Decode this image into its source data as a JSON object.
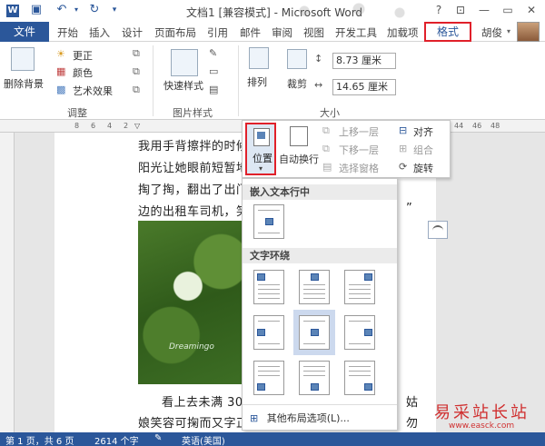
{
  "titlebar": {
    "title": "文档1 [兼容模式] - Microsoft Word",
    "help": "?",
    "minimize": "—",
    "close": "✕"
  },
  "tabs": {
    "file": "文件",
    "items": [
      "开始",
      "插入",
      "设计",
      "页面布局",
      "引用",
      "邮件",
      "审阅",
      "视图",
      "开发工具",
      "加载项"
    ],
    "format": "格式",
    "user": "胡俊"
  },
  "ribbon": {
    "remove_bg": "删除背景",
    "corrections": "更正",
    "color": "颜色",
    "artistic": "艺术效果",
    "group_adjust": "调整",
    "quick_styles": "快速样式",
    "group_picture_styles": "图片样式",
    "arrange": "排列",
    "crop": "裁剪",
    "height_value": "8.73 厘米",
    "width_value": "14.65 厘米",
    "group_size": "大小"
  },
  "arrange_panel": {
    "position": "位置",
    "wrap_text": "自动换行",
    "bring_forward": "上移一层",
    "send_backward": "下移一层",
    "selection_pane": "选择窗格",
    "align": "对齐",
    "group": "组合",
    "rotate": "旋转"
  },
  "position_menu": {
    "inline_header": "嵌入文本行中",
    "wrap_header": "文字环绕",
    "more_options": "其他布局选项(L)..."
  },
  "document": {
    "line1": "我用手背擦拌的时候",
    "line2": "阳光让她眼前短暂地",
    "line3": "掏了掏，翻出了出门",
    "line4": "边的出租车司机，笑",
    "line4_end": "”",
    "line5_start": "看上去未满  30",
    "line5_end": "姑",
    "line6_start": "娘笑容可掬而又字正",
    "line6_end": "勿",
    "photo_watermark": "Dreamingo"
  },
  "ruler": {
    "left_ticks": [
      "8",
      "6",
      "4",
      "2"
    ],
    "right_ticks": [
      "44",
      "46",
      "48"
    ]
  },
  "statusbar": {
    "page": "第 1 页，共 6 页",
    "words": "2614 个字",
    "language": "英语(美国)"
  },
  "watermark": {
    "cn": "易采站长站",
    "url": "www.easck.com"
  }
}
